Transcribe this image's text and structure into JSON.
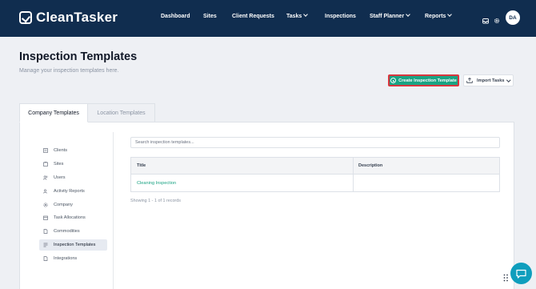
{
  "app": {
    "name": "CleanTasker"
  },
  "nav": {
    "items": [
      {
        "label": "Dashboard"
      },
      {
        "label": "Sites"
      },
      {
        "label": "Client Requests"
      },
      {
        "label": "Tasks"
      },
      {
        "label": "Inspections"
      },
      {
        "label": "Staff Planner"
      },
      {
        "label": "Reports"
      }
    ],
    "avatar_initials": "DA"
  },
  "page": {
    "title": "Inspection Templates",
    "subtitle": "Manage your inspection templates here."
  },
  "actions": {
    "create_label": "Create Inspection Template",
    "import_label": "Import Tasks"
  },
  "tabs": [
    {
      "label": "Company Templates",
      "active": true
    },
    {
      "label": "Location Templates",
      "active": false
    }
  ],
  "sidebar": {
    "items": [
      {
        "label": "Clients",
        "icon": "building-icon"
      },
      {
        "label": "Sites",
        "icon": "site-icon"
      },
      {
        "label": "Users",
        "icon": "users-icon"
      },
      {
        "label": "Activity Reports",
        "icon": "activity-icon"
      },
      {
        "label": "Company",
        "icon": "gear-icon"
      },
      {
        "label": "Task Allocations",
        "icon": "calendar-icon"
      },
      {
        "label": "Commodities",
        "icon": "document-icon"
      },
      {
        "label": "Inspection Templates",
        "icon": "checklist-icon",
        "active": true
      },
      {
        "label": "Integrations",
        "icon": "document-icon"
      }
    ]
  },
  "search": {
    "placeholder": "Search inspection templates..."
  },
  "table": {
    "columns": [
      "Title",
      "Description"
    ],
    "rows": [
      {
        "title": "Cleaning Inspection",
        "description": ""
      }
    ]
  },
  "records_text": "Showing 1 - 1 of 1 records",
  "colors": {
    "topbar": "#102d4f",
    "accent": "#1aa383",
    "highlight_border": "#d9363e",
    "chat": "#0f9ebd"
  }
}
